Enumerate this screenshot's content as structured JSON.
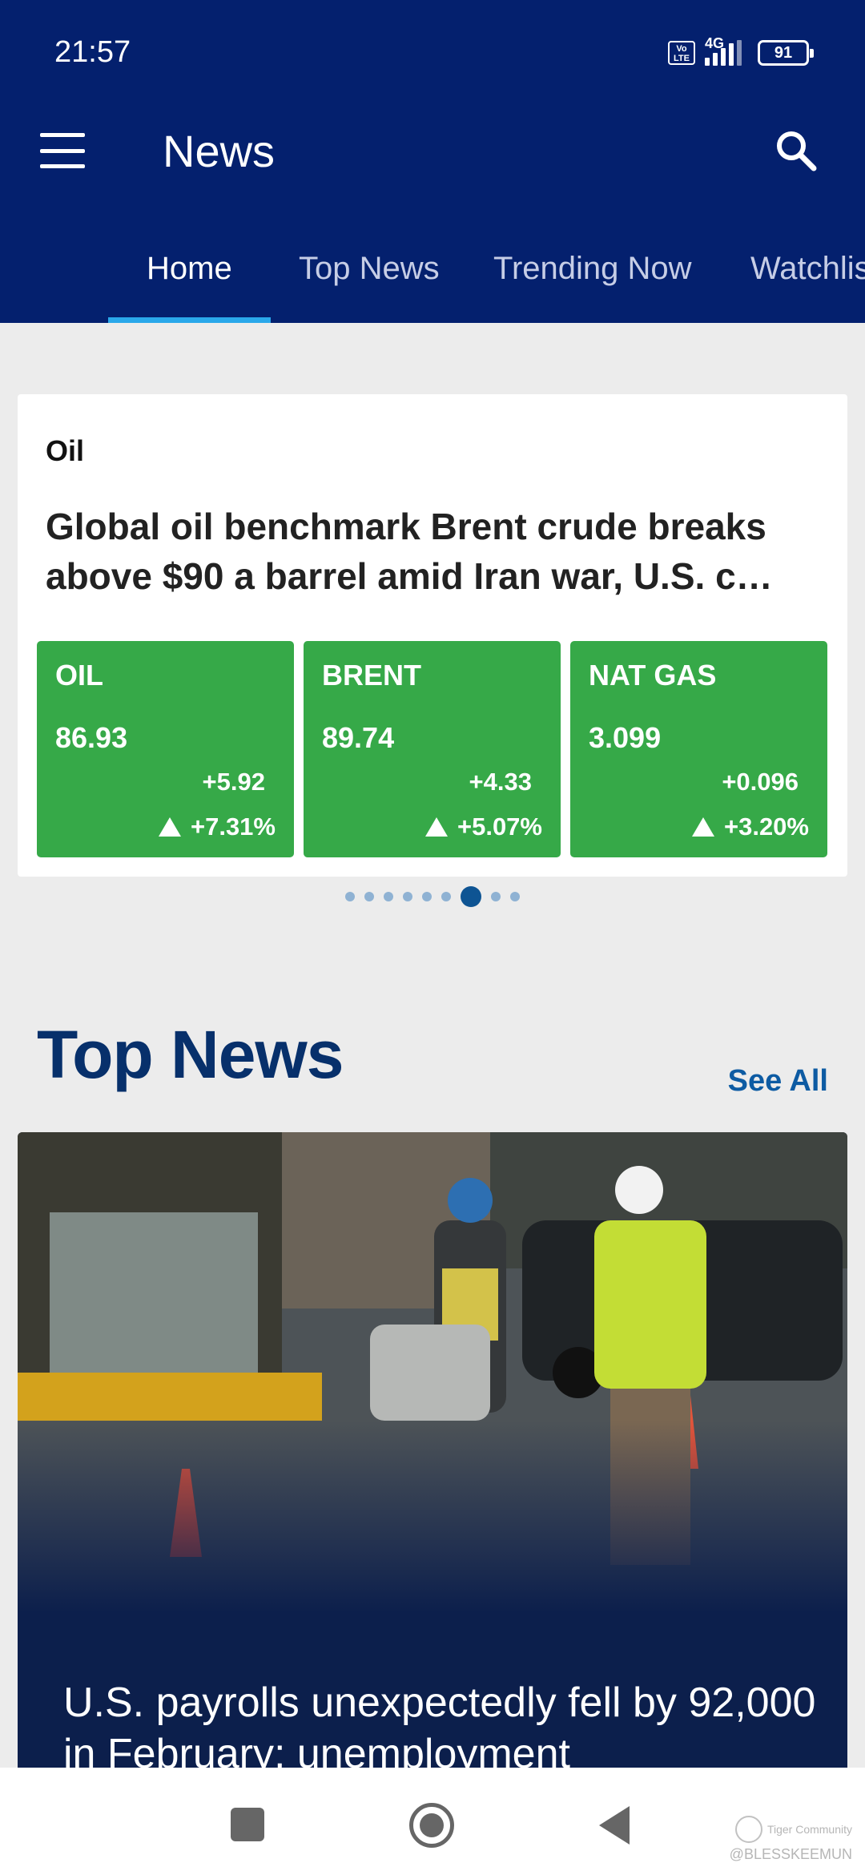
{
  "status_bar": {
    "time": "21:57",
    "volte": "Vo LTE",
    "network": "4G",
    "battery": "91"
  },
  "header": {
    "title": "News",
    "menu_icon": "hamburger-menu-icon",
    "search_icon": "search-icon"
  },
  "tabs": [
    {
      "label": "Home",
      "active": true
    },
    {
      "label": "Top News",
      "active": false
    },
    {
      "label": "Trending Now",
      "active": false
    },
    {
      "label": "Watchlis",
      "active": false
    }
  ],
  "market_card": {
    "category": "Oil",
    "headline": "Global oil benchmark Brent crude breaks above $90 a barrel amid Iran war, U.S. c…",
    "quotes": [
      {
        "name": "OIL",
        "price": "86.93",
        "change": "+5.92",
        "percent": "+7.31%"
      },
      {
        "name": "BRENT",
        "price": "89.74",
        "change": "+4.33",
        "percent": "+5.07%"
      },
      {
        "name": "NAT GAS",
        "price": "3.099",
        "change": "+0.096",
        "percent": "+3.20%"
      }
    ],
    "pager": {
      "total": 9,
      "active_index": 6
    }
  },
  "top_news": {
    "title": "Top News",
    "see_all": "See All",
    "headline": "U.S. payrolls unexpectedly fell by 92,000 in February; unemployment"
  },
  "watermark": {
    "brand": "Tiger Community",
    "user": "@BLESSKEEMUN"
  },
  "colors": {
    "header_bg": "#04206e",
    "tab_indicator": "#2aa8ea",
    "quote_up": "#36a948",
    "section_title": "#07306b",
    "link": "#0d5ba3"
  }
}
